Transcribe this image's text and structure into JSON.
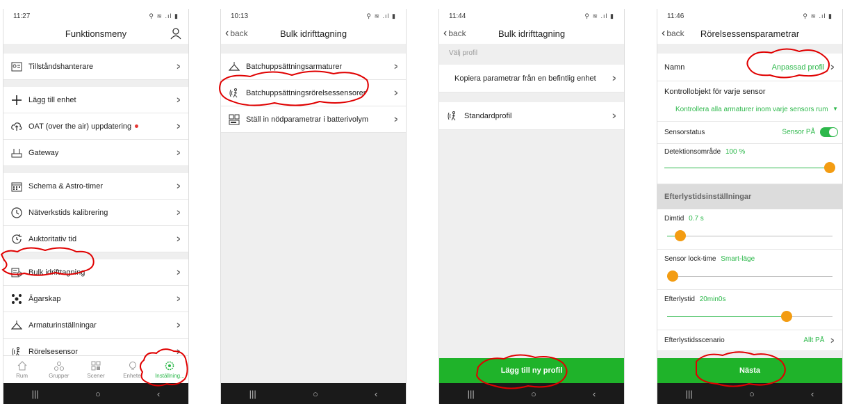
{
  "screens": [
    {
      "status_time": "11:27",
      "title": "Funktionsmeny",
      "group1": [
        {
          "label": "Tillståndshanterare",
          "icon": "id-card-icon"
        }
      ],
      "group2": [
        {
          "label": "Lägg till enhet",
          "icon": "plus-icon"
        },
        {
          "label": "OAT (over the air) uppdatering",
          "icon": "cloud-upload-icon",
          "badge": true
        },
        {
          "label": "Gateway",
          "icon": "gateway-icon"
        }
      ],
      "group3": [
        {
          "label": "Schema & Astro-timer",
          "icon": "calendar-icon"
        },
        {
          "label": "Nätverkstids kalibrering",
          "icon": "clock-icon"
        },
        {
          "label": "Auktoritativ tid",
          "icon": "clock-refresh-icon"
        }
      ],
      "group4": [
        {
          "label": "Bulk idrifttagning",
          "icon": "bulk-config-icon"
        },
        {
          "label": "Ägarskap",
          "icon": "ownership-icon"
        },
        {
          "label": "Armaturinställningar",
          "icon": "lamp-icon"
        },
        {
          "label": "Rörelsesensor",
          "icon": "motion-sensor-icon"
        }
      ],
      "tabs": [
        {
          "label": "Rum",
          "icon": "home-icon"
        },
        {
          "label": "Grupper",
          "icon": "groups-icon"
        },
        {
          "label": "Scener",
          "icon": "scenes-icon"
        },
        {
          "label": "Enheter",
          "icon": "bulb-icon"
        },
        {
          "label": "Inställning...",
          "icon": "settings-icon",
          "active": true
        }
      ]
    },
    {
      "status_time": "10:13",
      "back": "back",
      "title": "Bulk idrifttagning",
      "items": [
        {
          "label": "Batchuppsättningsarmaturer",
          "icon": "lamp-icon"
        },
        {
          "label": "Batchuppsättningsrörelsessensorer",
          "icon": "motion-sensor-icon"
        },
        {
          "label": "Ställ in nödparametrar i batterivolym",
          "icon": "battery-icon"
        }
      ]
    },
    {
      "status_time": "11:44",
      "back": "back",
      "title": "Bulk idrifttagning",
      "section": "Välj profil",
      "copy_label": "Kopiera parametrar från en befintlig enhet",
      "standard_label": "Standardprofil",
      "button": "Lägg till ny profil"
    },
    {
      "status_time": "11:46",
      "back": "back",
      "title": "Rörelsessensparametrar",
      "name_label": "Namn",
      "name_value": "Anpassad profil",
      "control_label": "Kontrollobjekt för varje sensor",
      "control_value": "Kontrollera alla armaturer inom varje sensors rum",
      "sensor_status_label": "Sensorstatus",
      "sensor_status_value": "Sensor PÅ",
      "detection_label": "Detektionsområde",
      "detection_value": "100 %",
      "detection_level": 1.0,
      "section": "Efterlystidsinställningar",
      "dim_label": "Dimtid",
      "dim_value": "0.7 s",
      "dim_level": 0.05,
      "lock_label": "Sensor lock-time",
      "lock_value": "Smart-läge",
      "lock_level": 0.0,
      "after_label": "Efterlystid",
      "after_value": "20min0s",
      "after_level": 0.74,
      "scenario_label": "Efterlystidsscenario",
      "scenario_value": "Allt PÅ",
      "button": "Nästa"
    }
  ],
  "nav": {
    "back": "|||",
    "home": "○",
    "recent": "‹"
  },
  "colors": {
    "accent": "#2db84b",
    "button": "#1fb32a",
    "slider": "#f39c12",
    "annotation": "#e00000",
    "badge": "#e53935"
  }
}
